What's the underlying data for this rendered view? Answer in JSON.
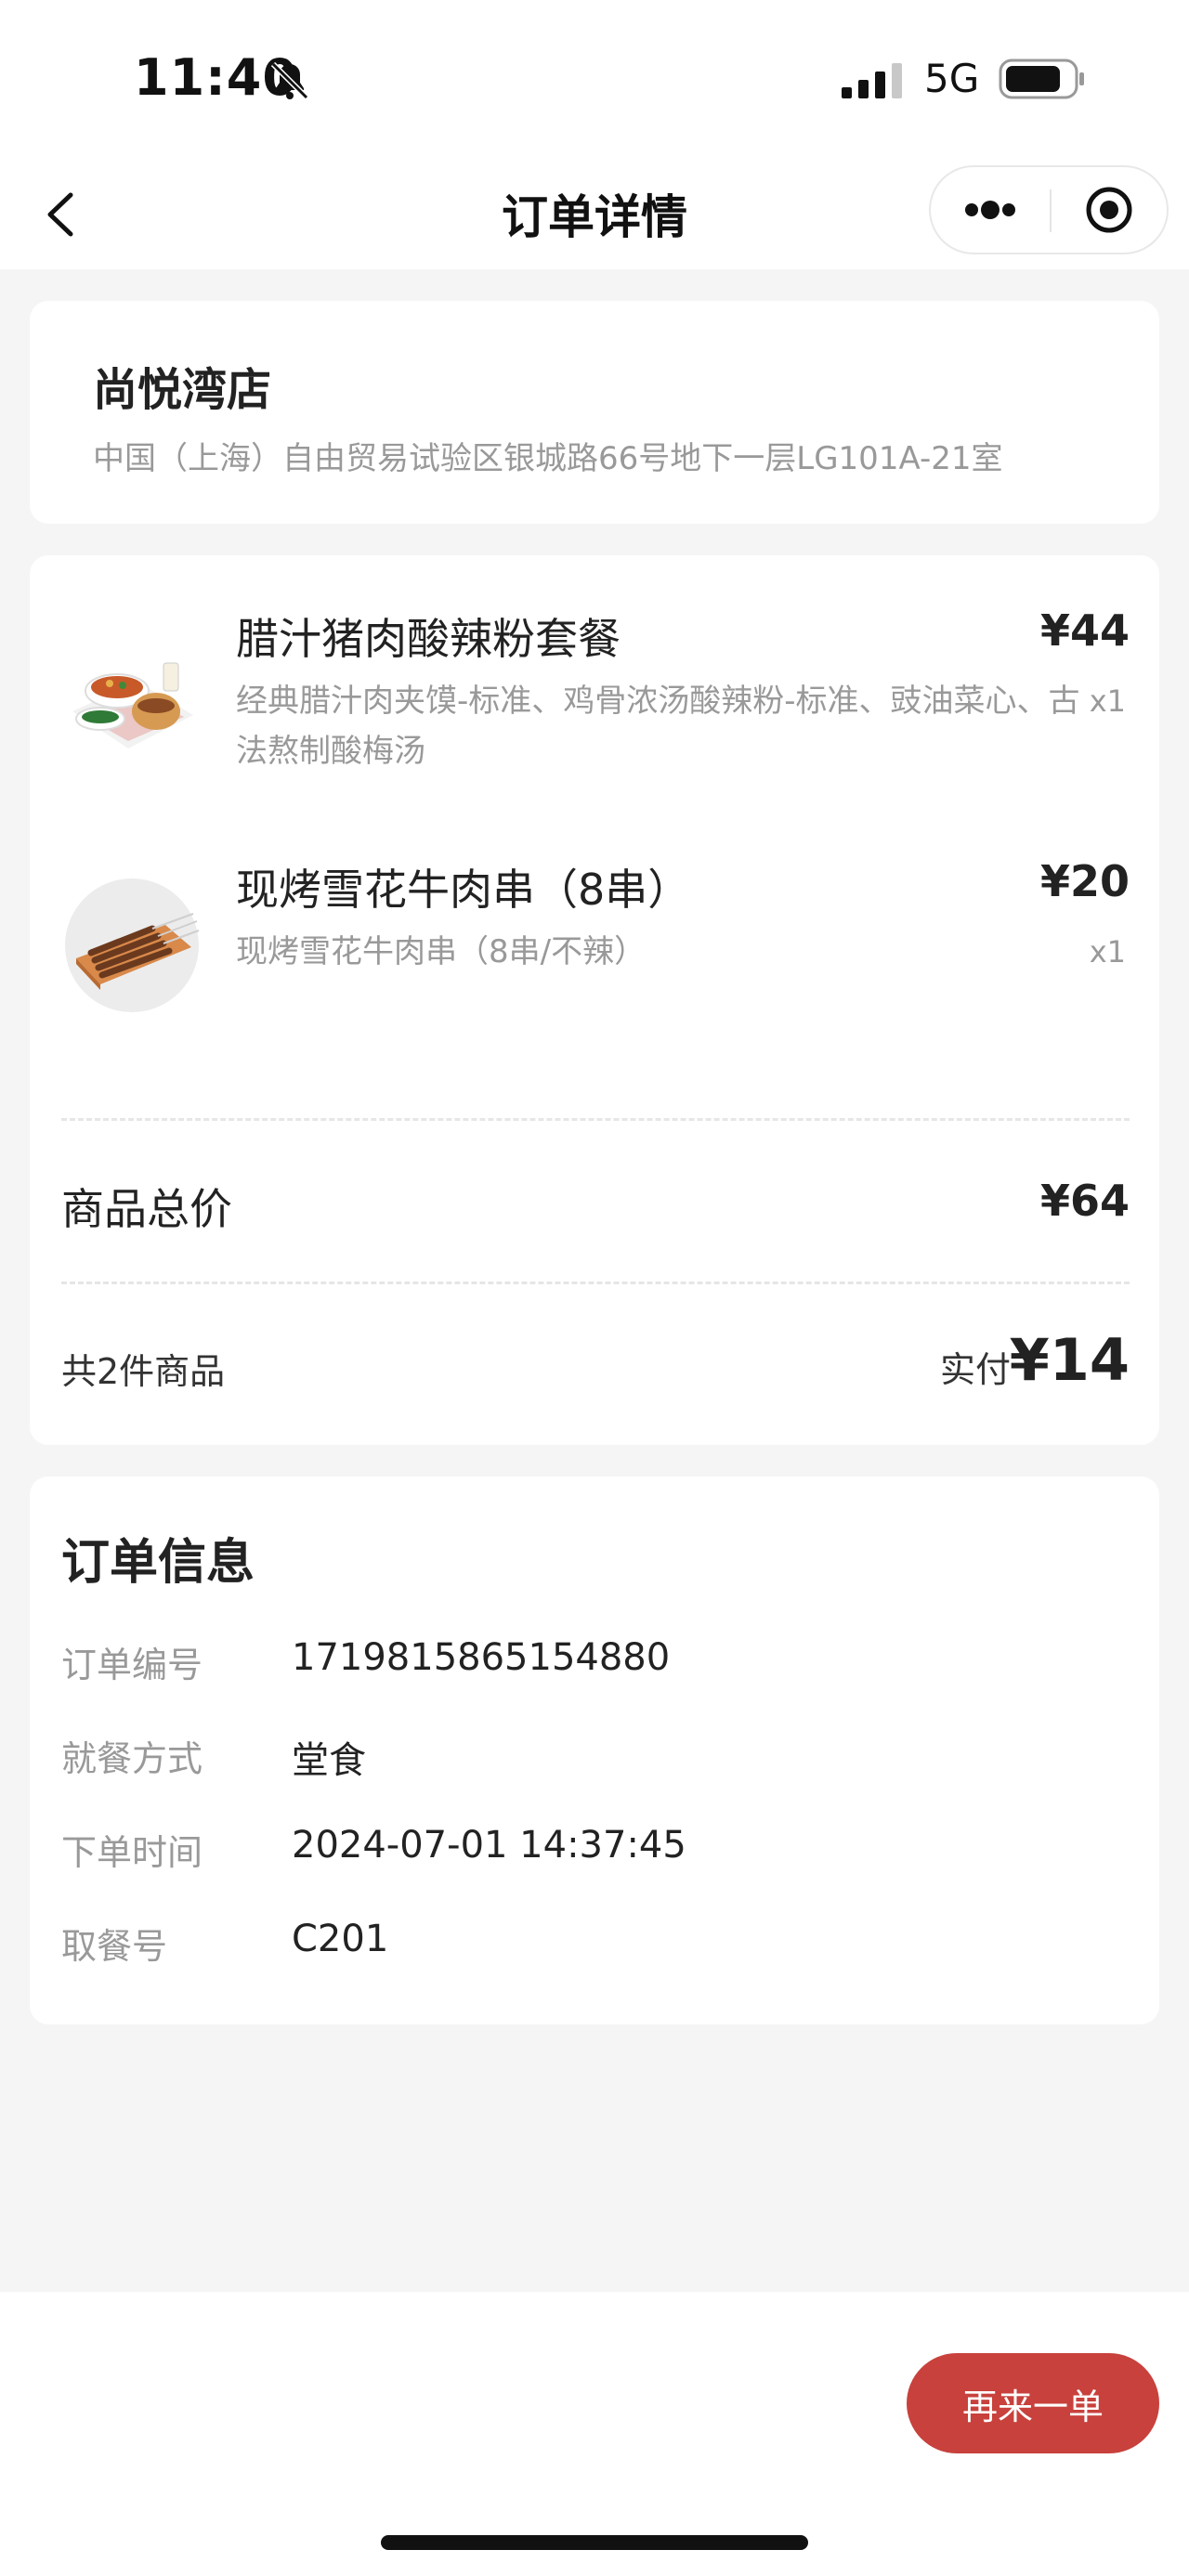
{
  "status_bar": {
    "time": "11:40",
    "network": "5G",
    "icons": [
      "bell-off-icon",
      "signal-icon",
      "battery-icon"
    ]
  },
  "nav": {
    "title": "订单详情",
    "icons": [
      "back-arrow-icon",
      "more-dots-icon",
      "close-target-icon"
    ]
  },
  "store": {
    "name": "尚悦湾店",
    "address": "中国（上海）自由贸易试验区银城路66号地下一层LG101A-21室"
  },
  "items": [
    {
      "name": "腊汁猪肉酸辣粉套餐",
      "description": "经典腊汁肉夹馍-标准、鸡骨浓汤酸辣粉-标准、豉油菜心、古法熬制酸梅汤",
      "price": "¥44",
      "quantity": "x1",
      "image": "combo-meal-image"
    },
    {
      "name": "现烤雪花牛肉串（8串）",
      "description": "现烤雪花牛肉串（8串/不辣）",
      "price": "¥20",
      "quantity": "x1",
      "image": "beef-skewers-image"
    }
  ],
  "summary": {
    "subtotal_label": "商品总价",
    "subtotal_value": "¥64",
    "count_label": "共2件商品",
    "paid_label": "实付",
    "paid_value": "¥14"
  },
  "order_info": {
    "title": "订单信息",
    "rows": [
      {
        "label": "订单编号",
        "value": "1719815865154880"
      },
      {
        "label": "就餐方式",
        "value": "堂食"
      },
      {
        "label": "下单时间",
        "value": "2024-07-01 14:37:45"
      },
      {
        "label": "取餐号",
        "value": "C201"
      }
    ]
  },
  "actions": {
    "reorder_label": "再来一单"
  },
  "colors": {
    "accent": "#c8413c",
    "background": "#f5f5f5",
    "card": "#ffffff",
    "muted_text": "#999999"
  }
}
